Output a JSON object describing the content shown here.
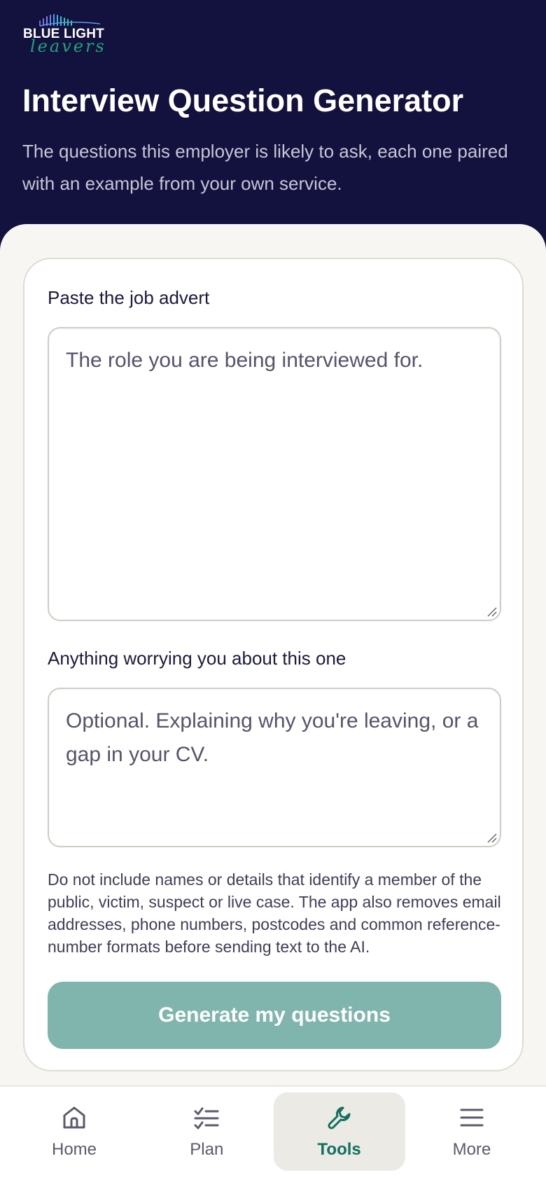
{
  "brand": {
    "logo_line1": "BLUE LIGHT",
    "logo_line2": "leavers"
  },
  "header": {
    "title": "Interview Question Generator",
    "subtitle": "The questions this employer is likely to ask, each one paired with an example from your own service."
  },
  "form": {
    "job_advert_label": "Paste the job advert",
    "job_advert_placeholder": "The role you are being interviewed for.",
    "job_advert_value": "",
    "worries_label": "Anything worrying you about this one",
    "worries_placeholder": "Optional. Explaining why you're leaving, or a gap in your CV.",
    "worries_value": "",
    "privacy_note": "Do not include names or details that identify a member of the public, victim, suspect or live case. The app also removes email addresses, phone numbers, postcodes and common reference-number formats before sending text to the AI.",
    "generate_label": "Generate my questions",
    "generate_enabled": false
  },
  "nav": {
    "items": [
      {
        "label": "Home",
        "icon": "home-icon",
        "active": false
      },
      {
        "label": "Plan",
        "icon": "checklist-icon",
        "active": false
      },
      {
        "label": "Tools",
        "icon": "wrench-icon",
        "active": true
      },
      {
        "label": "More",
        "icon": "menu-icon",
        "active": false
      }
    ]
  },
  "colors": {
    "header_bg": "#13113d",
    "accent": "#12705f",
    "button_disabled": "#80b5ad",
    "logo_script": "#1fa67a"
  }
}
